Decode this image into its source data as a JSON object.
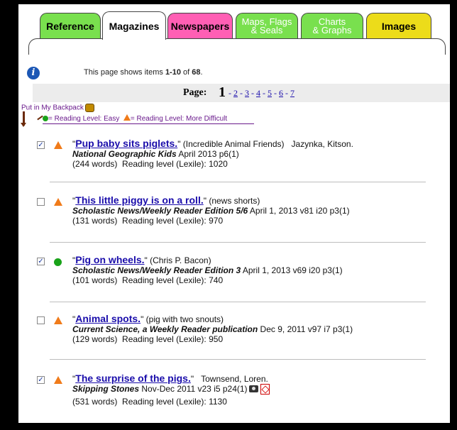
{
  "tabs": [
    {
      "label": "Reference",
      "color": "#79e04e",
      "text_color": "#0a0a0a"
    },
    {
      "label": "Magazines",
      "color": "#ffffff",
      "text_color": "#0a0a0a",
      "active": true
    },
    {
      "label": "Newspapers",
      "color": "#ff5fb4",
      "text_color": "#0a0a0a"
    },
    {
      "label": "Maps, Flags & Seals",
      "color": "#79e04e",
      "text_color": "#ffffff",
      "line1": "Maps, Flags",
      "line2": "& Seals"
    },
    {
      "label": "Charts & Graphs",
      "color": "#79e04e",
      "text_color": "#ffffff",
      "line1": "Charts",
      "line2": "& Graphs"
    },
    {
      "label": "Images",
      "color": "#ecdc1a",
      "text_color": "#0a0a0a"
    }
  ],
  "info": {
    "prefix": "This page shows items ",
    "range": "1-10",
    "mid": " of ",
    "total": "68",
    "suffix": "."
  },
  "pagination": {
    "label": "Page:",
    "current": "1",
    "pages": [
      "2",
      "3",
      "4",
      "5",
      "6",
      "7"
    ]
  },
  "backpack": {
    "label": "Put in My Backpack"
  },
  "legend": {
    "easy": "= Reading Level: Easy",
    "difficult": "= Reading Level: More Difficult"
  },
  "items": [
    {
      "checked": true,
      "level": "difficult",
      "title": "Pup baby sits piglets.",
      "extra": "(Incredible Animal Friends)",
      "author": "Jazynka, Kitson.",
      "pub": "National Geographic Kids",
      "cite": "April 2013 p6(1)",
      "words": "(244 words)",
      "lexile": "Reading level (Lexile): 1020"
    },
    {
      "checked": false,
      "level": "difficult",
      "title": "This little piggy is on a roll.",
      "extra": "(news shorts)",
      "author": "",
      "pub": "Scholastic News/Weekly Reader Edition 5/6",
      "cite": "April 1, 2013 v81 i20 p3(1)",
      "words": "(131 words)",
      "lexile": "Reading level (Lexile): 970"
    },
    {
      "checked": true,
      "level": "easy",
      "title": "Pig on wheels.",
      "extra": "(Chris P. Bacon)",
      "author": "",
      "pub": "Scholastic News/Weekly Reader Edition 3",
      "cite": "April 1, 2013 v69 i20 p3(1)",
      "words": "(101 words)",
      "lexile": "Reading level (Lexile): 740"
    },
    {
      "checked": false,
      "level": "difficult",
      "title": "Animal spots.",
      "extra": "(pig with two snouts)",
      "author": "",
      "pub": "Current Science, a Weekly Reader publication",
      "cite": "Dec 9, 2011 v97 i7 p3(1)",
      "words": "(129 words)",
      "lexile": "Reading level (Lexile): 950"
    },
    {
      "checked": true,
      "level": "difficult",
      "title": "The surprise of the pigs.",
      "extra": "",
      "author": "Townsend, Loren.",
      "pub": "Skipping Stones",
      "cite": "Nov-Dec 2011 v23 i5 p24(1)",
      "words": "(531 words)",
      "lexile": "Reading level (Lexile): 1130"
    }
  ]
}
